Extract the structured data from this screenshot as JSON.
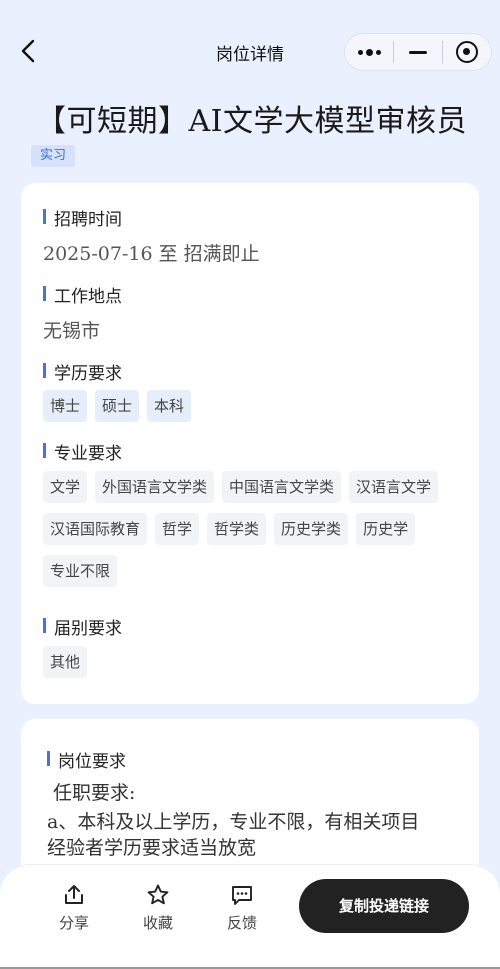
{
  "nav": {
    "title": "岗位详情"
  },
  "job": {
    "title": "【可短期】AI文学大模型审核员",
    "type_tag": "实习"
  },
  "sections": {
    "recruit_time": {
      "heading": "招聘时间",
      "value": "2025-07-16 至 招满即止"
    },
    "location": {
      "heading": "工作地点",
      "value": "无锡市"
    },
    "education": {
      "heading": "学历要求",
      "tags": [
        "博士",
        "硕士",
        "本科"
      ]
    },
    "major": {
      "heading": "专业要求",
      "tags": [
        "文学",
        "外国语言文学类",
        "中国语言文学类",
        "汉语言文学",
        "汉语国际教育",
        "哲学",
        "哲学类",
        "历史学类",
        "历史学",
        "专业不限"
      ]
    },
    "graduation": {
      "heading": "届别要求",
      "tags": [
        "其他"
      ]
    }
  },
  "requirements": {
    "heading": "岗位要求",
    "line1": "任职要求:",
    "line2": "a、本科及以上学历，专业不限，有相关项目",
    "line3": "经验者学历要求适当放宽"
  },
  "bottom": {
    "share": "分享",
    "favorite": "收藏",
    "feedback": "反馈",
    "copy_link": "复制投递链接"
  }
}
